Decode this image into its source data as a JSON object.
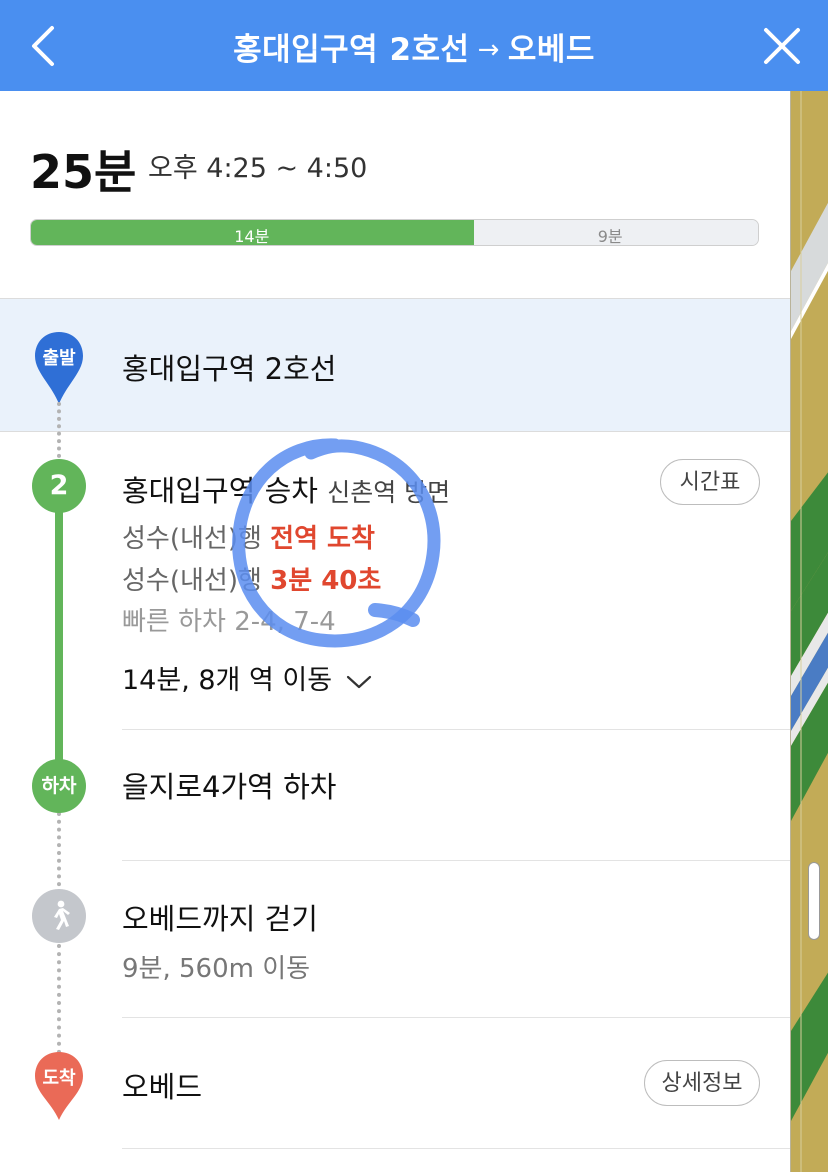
{
  "header": {
    "origin": "홍대입구역 2호선",
    "arrow": "→",
    "destination": "오베드",
    "bg_color": "#4a8ff0"
  },
  "summary": {
    "total_time": "25분",
    "time_range": "오후 4:25 ~ 4:50",
    "segments": [
      {
        "label": "14분",
        "minutes": 14,
        "color": "#62b55a"
      },
      {
        "label": "9분",
        "minutes": 9,
        "color": "#eef0f3"
      }
    ]
  },
  "steps": {
    "start": {
      "badge": "출발",
      "title": "홍대입구역 2호선"
    },
    "board": {
      "line_number": "2",
      "title": "홍대입구역 승차",
      "direction": "신촌역 방면",
      "timetable_button": "시간표",
      "arrivals": [
        {
          "train": "성수(내선)행",
          "status": "전역 도착"
        },
        {
          "train": "성수(내선)행",
          "status": "3분 40초"
        }
      ],
      "quick_exit": "빠른 하차 2-4, 7-4",
      "ride_summary": "14분, 8개 역 이동"
    },
    "alight": {
      "badge": "하차",
      "title": "을지로4가역 하차"
    },
    "walk": {
      "title": "오베드까지 걷기",
      "subtitle": "9분, 560m 이동"
    },
    "arrive": {
      "badge": "도착",
      "title": "오베드",
      "detail_button": "상세정보"
    }
  },
  "colors": {
    "line2_green": "#62b55a",
    "start_blue": "#2f6fd6",
    "arrive_red": "#ea6a57",
    "walk_grey": "#c4c7cc",
    "realtime_red": "#e0472f"
  }
}
